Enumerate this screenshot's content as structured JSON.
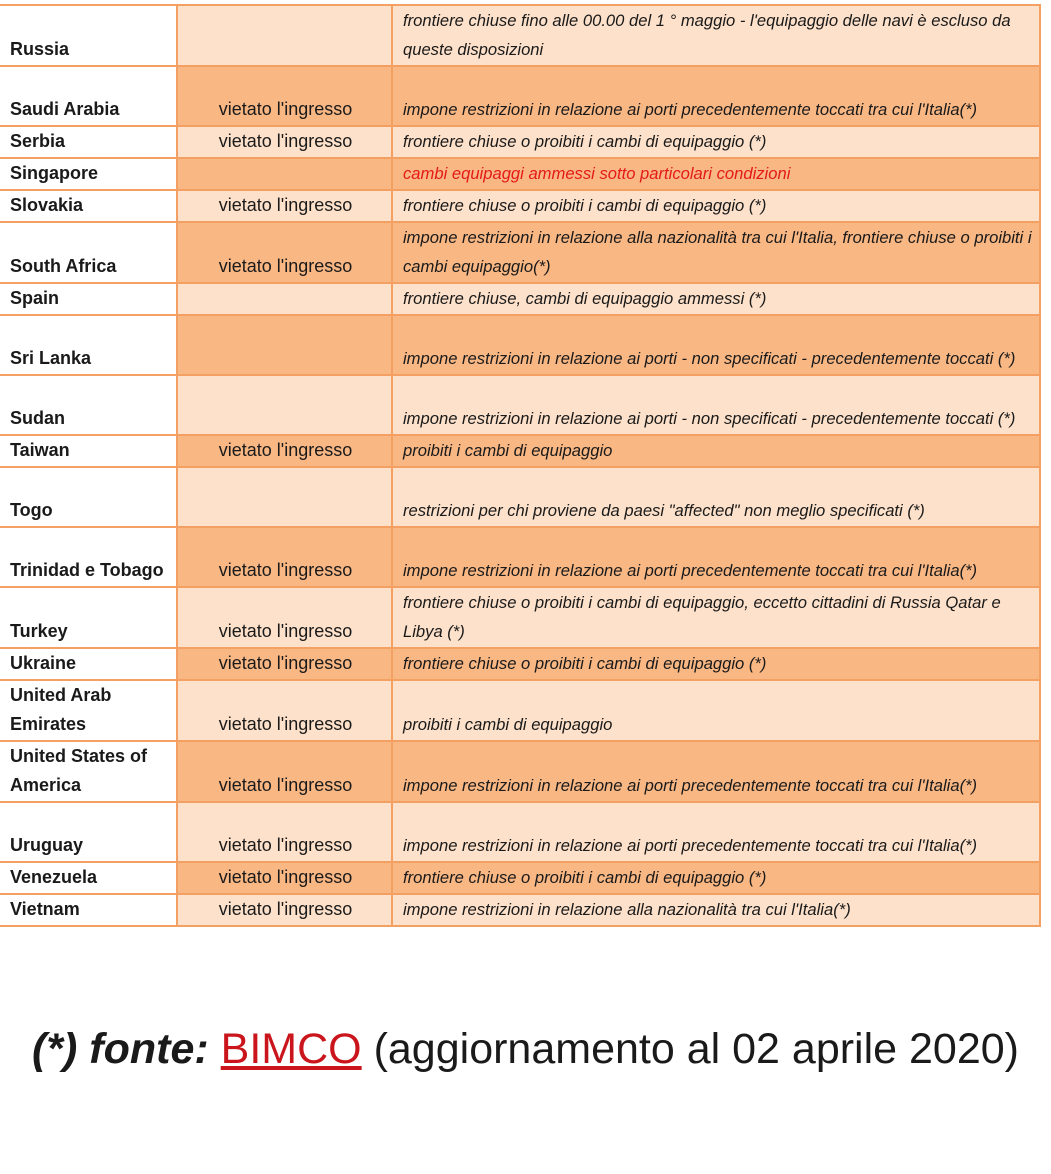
{
  "rows": [
    {
      "country": "Russia",
      "entry": "",
      "note": "frontiere chiuse fino alle 00.00 del 1 ° maggio - l'equipaggio delle navi è escluso da queste disposizioni",
      "shade": "light",
      "lines": 2
    },
    {
      "country": "Saudi Arabia",
      "entry": "vietato l'ingresso",
      "note": "impone restrizioni in relazione ai porti precedentemente toccati tra cui l'Italia(*)",
      "shade": "dark",
      "lines": 2
    },
    {
      "country": "Serbia",
      "entry": "vietato l'ingresso",
      "note": "frontiere chiuse o proibiti i cambi di equipaggio (*)",
      "shade": "light",
      "lines": 1
    },
    {
      "country": "Singapore",
      "entry": "",
      "note": "cambi equipaggi ammessi sotto particolari condizioni",
      "shade": "dark",
      "lines": 1,
      "highlight": true
    },
    {
      "country": "Slovakia",
      "entry": "vietato l'ingresso",
      "note": "frontiere chiuse o proibiti i cambi di equipaggio (*)",
      "shade": "light",
      "lines": 1
    },
    {
      "country": "South Africa",
      "entry": "vietato l'ingresso",
      "note": "impone restrizioni in relazione alla nazionalità tra cui l'Italia, frontiere chiuse o proibiti i cambi equipaggio(*)",
      "shade": "dark",
      "lines": 2
    },
    {
      "country": "Spain",
      "entry": "",
      "note": "frontiere chiuse, cambi di equipaggio ammessi (*)",
      "shade": "light",
      "lines": 1
    },
    {
      "country": "Sri Lanka",
      "entry": "",
      "note": "impone restrizioni in relazione ai porti - non specificati - precedentemente toccati (*)",
      "shade": "dark",
      "lines": 2
    },
    {
      "country": "Sudan",
      "entry": "",
      "note": "impone restrizioni in relazione ai porti - non specificati - precedentemente toccati (*)",
      "shade": "light",
      "lines": 2
    },
    {
      "country": "Taiwan",
      "entry": "vietato l'ingresso",
      "note": "proibiti i cambi di equipaggio",
      "shade": "dark",
      "lines": 1
    },
    {
      "country": "Togo",
      "entry": "",
      "note": "restrizioni per chi proviene da paesi \"affected\" non meglio specificati (*)",
      "shade": "light",
      "lines": 2
    },
    {
      "country": "Trinidad e Tobago",
      "entry": "vietato l'ingresso",
      "note": "impone restrizioni in relazione ai porti precedentemente toccati tra cui l'Italia(*)",
      "shade": "dark",
      "lines": 2
    },
    {
      "country": "Turkey",
      "entry": "vietato l'ingresso",
      "note": "frontiere chiuse o proibiti i cambi di equipaggio, eccetto cittadini di Russia Qatar e Libya (*)",
      "shade": "light",
      "lines": 2
    },
    {
      "country": "Ukraine",
      "entry": "vietato l'ingresso",
      "note": "frontiere chiuse o proibiti i cambi di equipaggio (*)",
      "shade": "dark",
      "lines": 1
    },
    {
      "country": "United Arab Emirates",
      "entry": "vietato l'ingresso",
      "note": "proibiti i cambi di equipaggio",
      "shade": "light",
      "lines": 2
    },
    {
      "country": "United States of America",
      "entry": "vietato l'ingresso",
      "note": "impone restrizioni in relazione ai porti precedentemente toccati tra cui l'Italia(*)",
      "shade": "dark",
      "lines": 2
    },
    {
      "country": "Uruguay",
      "entry": "vietato l'ingresso",
      "note": "impone restrizioni in relazione ai porti precedentemente toccati tra cui l'Italia(*)",
      "shade": "light",
      "lines": 2
    },
    {
      "country": "Venezuela",
      "entry": "vietato l'ingresso",
      "note": "frontiere chiuse o proibiti i cambi di equipaggio (*)",
      "shade": "dark",
      "lines": 1
    },
    {
      "country": "Vietnam",
      "entry": "vietato l'ingresso",
      "note": "impone restrizioni in relazione alla nazionalità tra cui l'Italia(*)",
      "shade": "light",
      "lines": 1
    }
  ],
  "colors": {
    "dark": "#f9b784",
    "light": "#fde1ca",
    "border": "#f3a062",
    "highlight": "#e41a1a",
    "link": "#c9151b"
  },
  "footer": {
    "label": "(*) fonte:",
    "link": "BIMCO",
    "text": " (aggiornamento al 02 aprile 2020)"
  }
}
